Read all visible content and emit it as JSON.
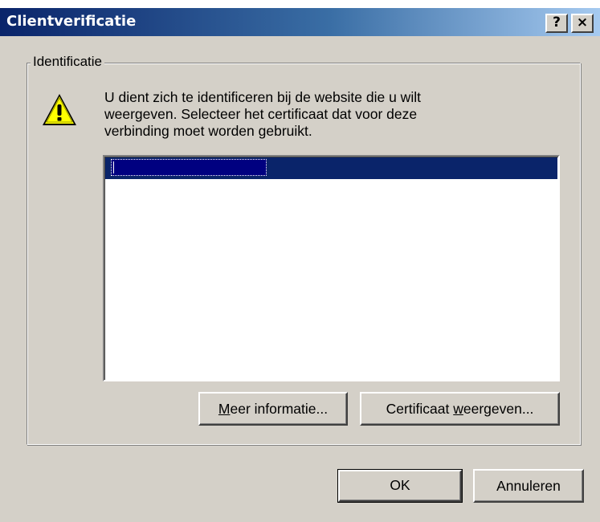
{
  "window": {
    "title": "Clientverificatie",
    "help_button": "?",
    "close_button": "×"
  },
  "groupbox": {
    "legend": "Identificatie"
  },
  "message": {
    "lines": [
      "U dient zich te identificeren bij de website die u wilt",
      "weergeven. Selecteer het certificaat dat voor deze",
      "verbinding moet worden gebruikt."
    ]
  },
  "certificate_list": {
    "items": [
      ""
    ],
    "selected_index": 0
  },
  "buttons": {
    "meer_informatie": {
      "prefix": "",
      "accel": "M",
      "suffix": "eer informatie..."
    },
    "certificaat_weergeven": {
      "prefix": "Certificaat ",
      "accel": "w",
      "suffix": "eergeven..."
    },
    "ok": "OK",
    "annuleren": "Annuleren"
  },
  "icons": {
    "warning": "warning-icon",
    "help": "help-icon",
    "close": "close-icon"
  },
  "colors": {
    "title_gradient_start": "#0a246a",
    "title_gradient_end": "#a6caf0",
    "dialog_face": "#d4d0c8",
    "selection": "#0a246a",
    "warning_yellow": "#ffff00"
  }
}
